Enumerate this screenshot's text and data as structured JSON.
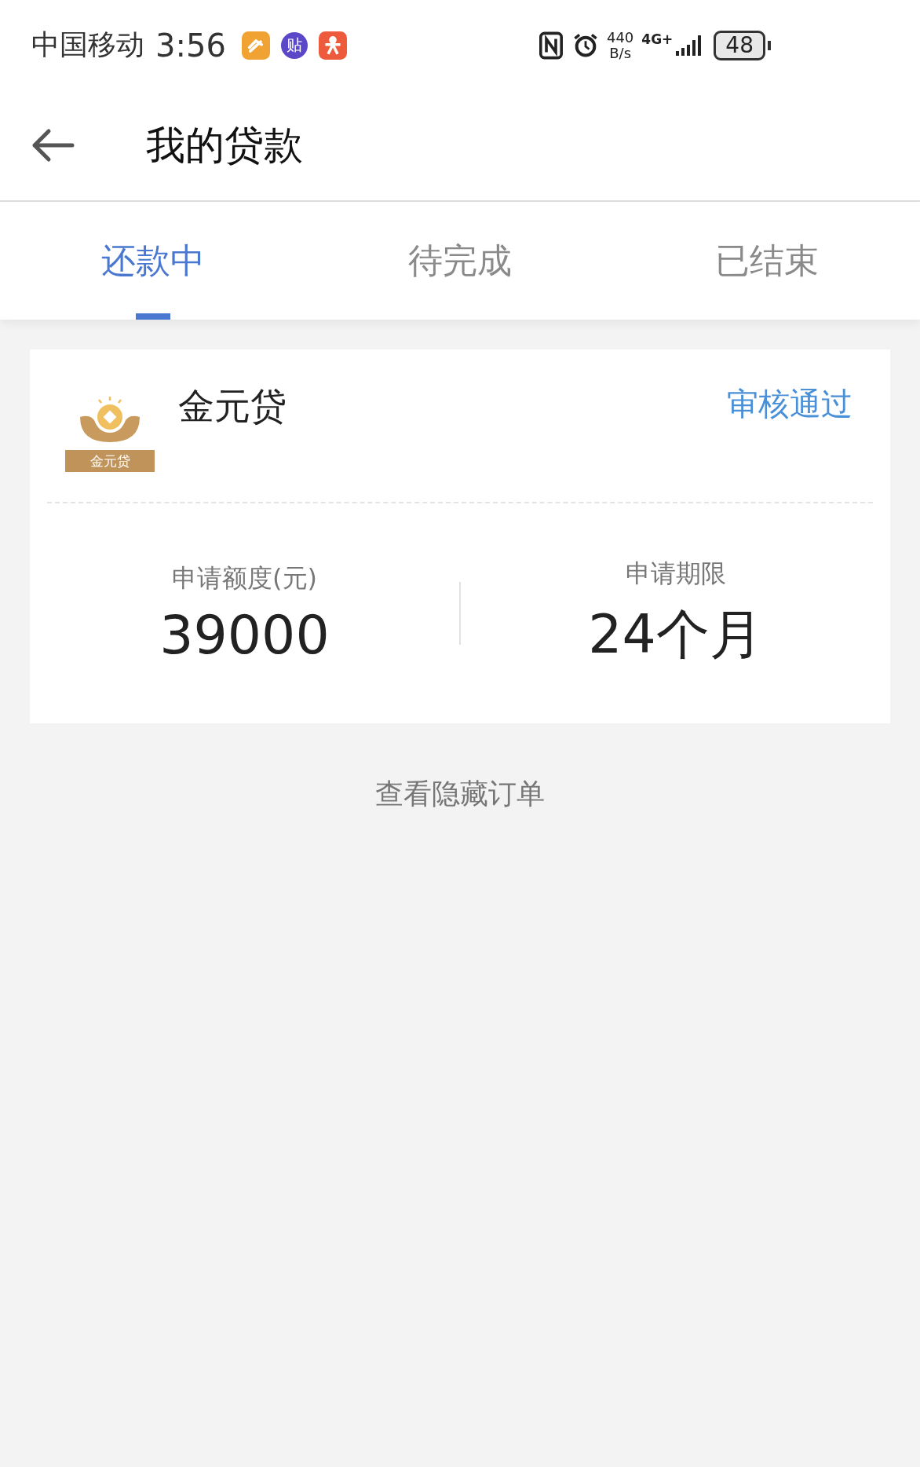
{
  "status_bar": {
    "carrier": "中国移动",
    "time": "3:56",
    "app_badge": "贴",
    "net_speed": "440",
    "net_unit": "B/s",
    "network": "4G+",
    "battery": "48"
  },
  "header": {
    "title": "我的贷款"
  },
  "tabs": [
    {
      "label": "还款中",
      "selected": true
    },
    {
      "label": "待完成",
      "selected": false
    },
    {
      "label": "已结束",
      "selected": false
    }
  ],
  "loans": [
    {
      "name": "金元贷",
      "logo_text": "金元贷",
      "status": "审核通过",
      "amount_label": "申请额度(元)",
      "amount": "39000",
      "term_label": "申请期限",
      "term": "24个月"
    }
  ],
  "hidden_orders_link": "查看隐藏订单"
}
